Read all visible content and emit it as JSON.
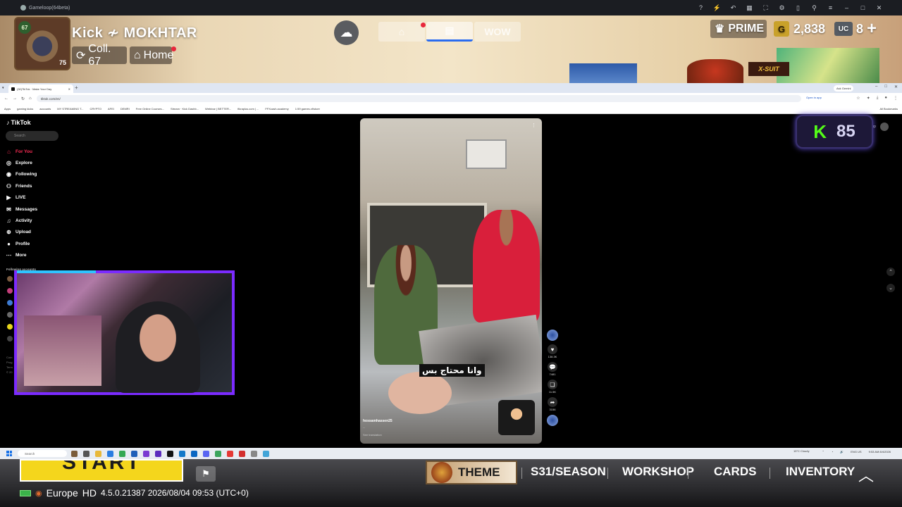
{
  "emulator": {
    "title": "Gameloop(64beta)"
  },
  "game_header": {
    "level_badge": "67",
    "avatar_level": "75",
    "player_name": "Kick ≁ MOKHTAR",
    "coll_label": "Coll. 67",
    "home_label": "Home",
    "mode_tabs": [
      "",
      "",
      "WOW"
    ],
    "prime_label": "PRIME",
    "g_coin_icon": "G",
    "g_coin_value": "2,838",
    "uc_icon": "UC",
    "uc_value": "8",
    "add_label": "+",
    "event_banner": "X-SUIT"
  },
  "browser": {
    "tab_title": "(30)TikTok · Make Your Day",
    "url": "tiktok.com/en/",
    "open_in_app": "Open in app",
    "ask_gemini": "Ask Gemini",
    "bookmarks": [
      "Apps",
      "gaming kicks",
      "accounts",
      "MY STREAMING T...",
      "CRYPTO",
      "AFEI",
      "DEMRI",
      "Free Online Courses...",
      "Stream · Kick Dashb...",
      "Webinar | BETTER...",
      "fikraplus.com | ...",
      "FFXcash.academy",
      "1:59 games.xf/store"
    ],
    "all_bookmarks": "All Bookmarks"
  },
  "tiktok": {
    "logo": "TikTok",
    "search_placeholder": "Search",
    "nav": [
      {
        "label": "For You",
        "icon": "home-icon"
      },
      {
        "label": "Explore",
        "icon": "compass-icon"
      },
      {
        "label": "Following",
        "icon": "following-icon"
      },
      {
        "label": "Friends",
        "icon": "friends-icon"
      },
      {
        "label": "LIVE",
        "icon": "live-icon"
      },
      {
        "label": "Messages",
        "icon": "message-icon"
      },
      {
        "label": "Activity",
        "icon": "bell-icon"
      },
      {
        "label": "Upload",
        "icon": "upload-icon"
      },
      {
        "label": "Profile",
        "icon": "profile-icon"
      },
      {
        "label": "More",
        "icon": "more-icon"
      }
    ],
    "following_accounts_label": "Following accounts",
    "footer_lines": [
      "Com",
      "Prog",
      "Term",
      "© 20"
    ],
    "video": {
      "caption_arabic": "وانا محتاج بس",
      "username": "hossamhassen25",
      "description": "...",
      "see_translation": "See translation"
    },
    "actions": [
      {
        "icon": "heart-icon",
        "count": "138.3K"
      },
      {
        "icon": "comment-icon",
        "count": "7481"
      },
      {
        "icon": "bookmark-icon",
        "count": "11.5K"
      },
      {
        "icon": "share-icon",
        "count": "3156"
      }
    ],
    "right_tools_label": "App"
  },
  "kick_badge": {
    "logo": "K",
    "count": "85"
  },
  "taskbar": {
    "search_placeholder": "Search",
    "weather": "15°C Cloudy",
    "lang": "ENG US",
    "time": "9:53 AM",
    "date": "8/4/2026"
  },
  "game_bottom": {
    "start_label": "START",
    "server_label": "Europe",
    "quality_label": "HD",
    "version": "4.5.0.21387 2026/08/04 09:53 (UTC+0)",
    "theme_label": "THEME",
    "menu": [
      "S31/SEASON",
      "WORKSHOP",
      "CARDS",
      "INVENTORY"
    ]
  }
}
